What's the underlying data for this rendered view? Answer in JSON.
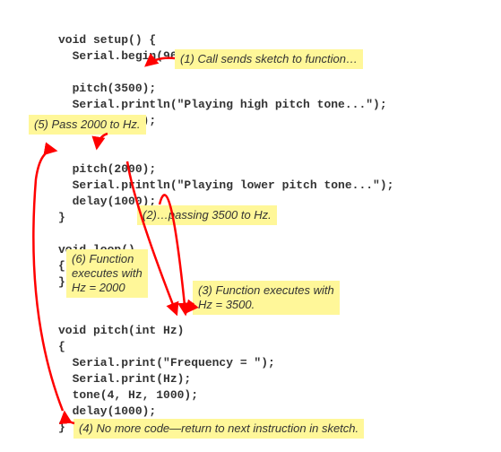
{
  "code": {
    "l1": "void setup() {",
    "l2": "  Serial.begin(9600);",
    "l3": "",
    "l4": "  pitch(3500);",
    "l5": "  Serial.println(\"Playing high pitch tone...\");",
    "l6": "  delay(1000);",
    "l7": "",
    "l8": "",
    "l9": "  pitch(2000);",
    "l10": "  Serial.println(\"Playing lower pitch tone...\");",
    "l11": "  delay(1000);",
    "l12": "}",
    "l13": "",
    "l14": "void loop()",
    "l15": "{",
    "l16": "}",
    "l17": "",
    "l18": "",
    "l19": "void pitch(int Hz)",
    "l20": "{",
    "l21": "  Serial.print(\"Frequency = \");",
    "l22": "  Serial.print(Hz);",
    "l23": "  tone(4, Hz, 1000);",
    "l24": "  delay(1000);",
    "l25": "}"
  },
  "annotations": {
    "a1": "(1) Call sends sketch to function…",
    "a2": "(2)…passing 3500  to Hz.",
    "a3": "(3) Function executes with\nHz = 3500.",
    "a4": "(4) No more code—return to next instruction in sketch.",
    "a5": "(5) Pass 2000 to Hz.",
    "a6": "(6) Function\nexecutes with\nHz = 2000"
  }
}
